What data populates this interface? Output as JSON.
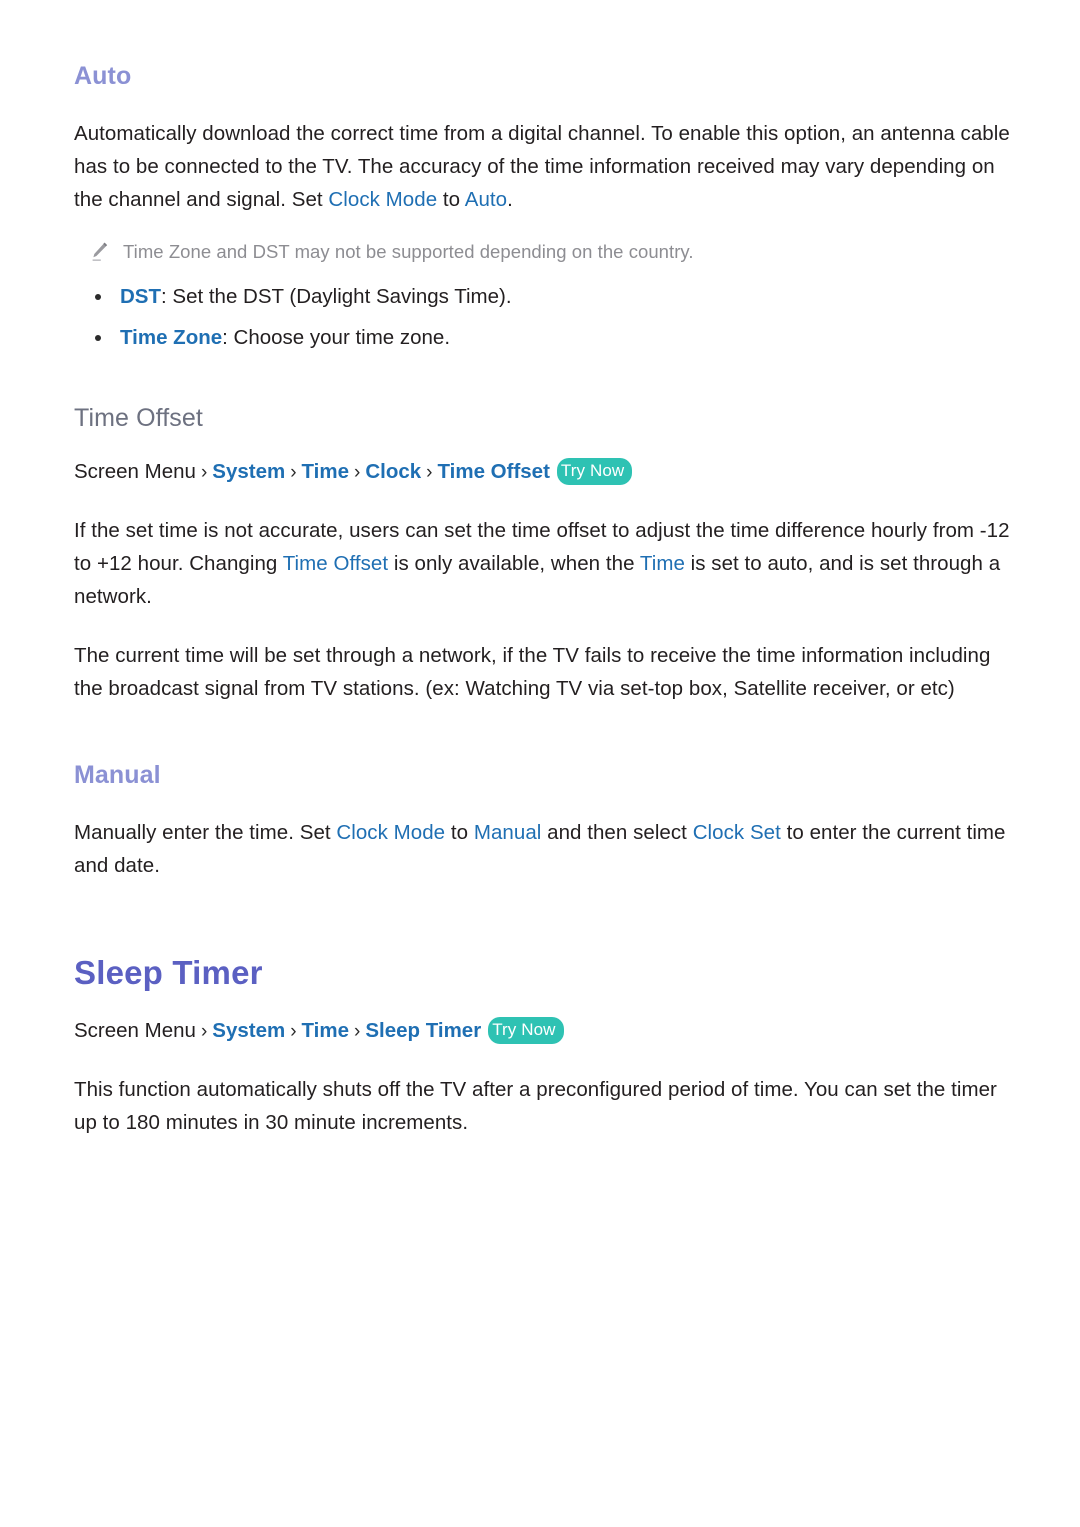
{
  "sections": {
    "auto": {
      "heading": "Auto",
      "paragraph_1_part_1": "Automatically download the correct time from a digital channel. To enable this option, an antenna cable has to be connected to the TV. The accuracy of the time information received may vary depending on the channel and signal. Set ",
      "paragraph_1_link_1": "Clock Mode",
      "paragraph_1_part_2": " to ",
      "paragraph_1_link_2": "Auto",
      "paragraph_1_part_3": ".",
      "note_icon": "pencil-icon",
      "note_text": "Time Zone and DST may not be supported depending on the country.",
      "bullets": [
        {
          "term": "DST",
          "text": ": Set the DST (Daylight Savings Time)."
        },
        {
          "term": "Time Zone",
          "text": ": Choose your time zone."
        }
      ]
    },
    "time_offset": {
      "heading": "Time Offset",
      "breadcrumb": {
        "root": "Screen Menu",
        "separator": "›",
        "items": [
          "System",
          "Time",
          "Clock",
          "Time Offset"
        ],
        "badge": "Try Now"
      },
      "paragraph_1_part_1": "If the set time is not accurate, users can set the time offset to adjust the time difference hourly from -12 to +12 hour. Changing ",
      "paragraph_1_link_1": "Time Offset",
      "paragraph_1_part_2": " is only available, when the ",
      "paragraph_1_link_2": "Time",
      "paragraph_1_part_3": " is set to auto, and is set through a network.",
      "paragraph_2": "The current time will be set through a network, if the TV fails to receive the time information including the broadcast signal from TV stations. (ex: Watching TV via set-top box, Satellite receiver, or etc)"
    },
    "manual": {
      "heading": "Manual",
      "paragraph_1_part_1": "Manually enter the time. Set ",
      "paragraph_1_link_1": "Clock Mode",
      "paragraph_1_part_2": " to ",
      "paragraph_1_link_2": "Manual",
      "paragraph_1_part_3": " and then select ",
      "paragraph_1_link_3": "Clock Set",
      "paragraph_1_part_4": " to enter the current time and date."
    },
    "sleep_timer": {
      "heading": "Sleep Timer",
      "breadcrumb": {
        "root": "Screen Menu",
        "separator": "›",
        "items": [
          "System",
          "Time",
          "Sleep Timer"
        ],
        "badge": "Try Now"
      },
      "paragraph_1": "This function automatically shuts off the TV after a preconfigured period of time. You can set the timer up to 180 minutes in 30 minute increments."
    }
  },
  "colors": {
    "sub_heading": "#8b91d4",
    "main_heading": "#5b60c2",
    "section_heading": "#6d7180",
    "link": "#1f6fb3",
    "badge_bg": "#2ec2b3",
    "note_text": "#8d8d92",
    "body_text": "#231f20"
  }
}
